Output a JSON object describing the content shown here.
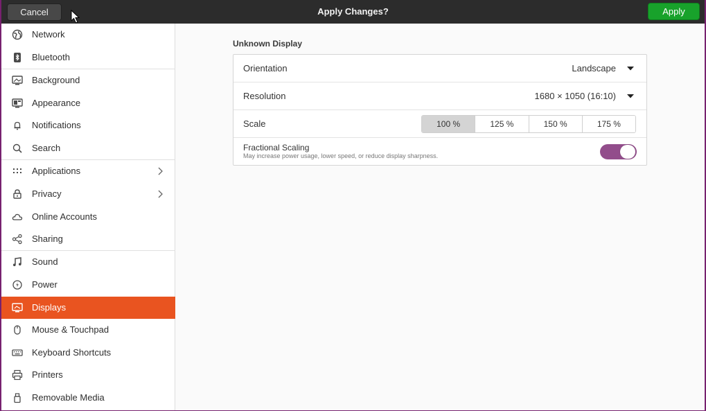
{
  "header": {
    "title": "Apply Changes?",
    "cancel_label": "Cancel",
    "apply_label": "Apply",
    "apply_color": "#18a22b"
  },
  "sidebar": {
    "accent_color": "#e95420",
    "items": [
      {
        "label": "Network",
        "icon": "network-icon"
      },
      {
        "label": "Bluetooth",
        "icon": "bluetooth-icon"
      },
      {
        "label": "Background",
        "icon": "background-icon"
      },
      {
        "label": "Appearance",
        "icon": "appearance-icon"
      },
      {
        "label": "Notifications",
        "icon": "bell-icon"
      },
      {
        "label": "Search",
        "icon": "search-icon"
      },
      {
        "label": "Applications",
        "icon": "grid-icon",
        "has_submenu": true
      },
      {
        "label": "Privacy",
        "icon": "lock-icon",
        "has_submenu": true
      },
      {
        "label": "Online Accounts",
        "icon": "cloud-icon"
      },
      {
        "label": "Sharing",
        "icon": "share-icon"
      },
      {
        "label": "Sound",
        "icon": "music-note-icon"
      },
      {
        "label": "Power",
        "icon": "power-icon"
      },
      {
        "label": "Displays",
        "icon": "display-icon",
        "active": true
      },
      {
        "label": "Mouse & Touchpad",
        "icon": "mouse-icon"
      },
      {
        "label": "Keyboard Shortcuts",
        "icon": "keyboard-icon"
      },
      {
        "label": "Printers",
        "icon": "printer-icon"
      },
      {
        "label": "Removable Media",
        "icon": "removable-media-icon"
      }
    ]
  },
  "display": {
    "section_title": "Unknown Display",
    "orientation": {
      "label": "Orientation",
      "value": "Landscape"
    },
    "resolution": {
      "label": "Resolution",
      "value": "1680 × 1050 (16:10)"
    },
    "scale": {
      "label": "Scale",
      "options": [
        "100 %",
        "125 %",
        "150 %",
        "175 %"
      ],
      "selected": "100 %"
    },
    "fractional_scaling": {
      "title": "Fractional Scaling",
      "subtitle": "May increase power usage, lower speed, or reduce display sharpness.",
      "enabled": true,
      "toggle_color": "#924d8b"
    }
  }
}
